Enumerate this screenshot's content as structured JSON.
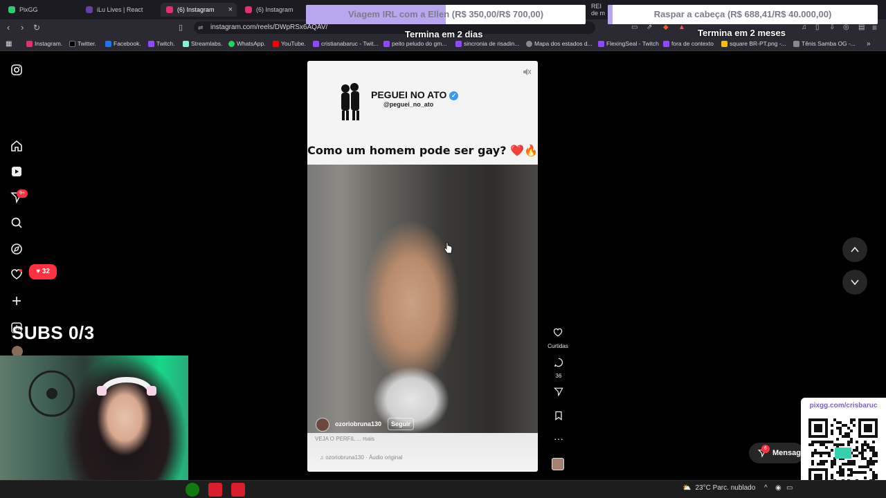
{
  "browser": {
    "tabs": [
      {
        "title": "PixGG"
      },
      {
        "title": "iLu Lives | React"
      },
      {
        "title": "(6) Instagram",
        "active": true
      },
      {
        "title": "(6) Instagram"
      }
    ],
    "url": "instagram.com/reels/DWpRSx6AQAV/",
    "bookmarks": [
      "Instagram.",
      "Twitter.",
      "Facebook.",
      "Twitch.",
      "Streamlabs.",
      "WhatsApp.",
      "YouTube.",
      "cristianabaruc - Twit...",
      "peito peludo do gm...",
      "sincronia de risadin...",
      "Mapa dos estados d...",
      "FlexingSeal - Twitch",
      "fora de contexto",
      "square BR-PT.png -...",
      "Tênis Samba OG -..."
    ],
    "hidden_tab_fragment": "REI de m"
  },
  "goals": {
    "left": {
      "title": "Viagem IRL com a Ellen (R$ 350,00/R$ 700,00)",
      "progress": 0.5,
      "subtitle": "Termina em 2 dias"
    },
    "right": {
      "title": "Raspar a cabeça (R$ 688,41/R$ 40.000,00)",
      "progress": 0.017,
      "subtitle": "Termina em 2 meses"
    }
  },
  "instagram": {
    "sidebar": {
      "like_count": "32",
      "notif_count": "9+"
    },
    "reel": {
      "header_title": "PEGUEI NO ATO",
      "header_handle": "@peguei_no_ato",
      "caption_title": "Como um homem pode ser gay? ❤️🔥",
      "username": "ozoriobruna130",
      "follow_label": "Seguir",
      "description": "VEJA O PERFIL ... mais",
      "audio": "ozoriobruna130 · Áudio original"
    },
    "actions": {
      "likes_label": "Curtidas",
      "comments_count": "36"
    },
    "messages": {
      "label": "Mensag",
      "badge": "6"
    }
  },
  "stream": {
    "subs_label": "SUBS 0/3",
    "qr_url": "pixgg.com/crisbaruc"
  },
  "taskbar": {
    "weather": "23°C  Parc. nublado"
  }
}
